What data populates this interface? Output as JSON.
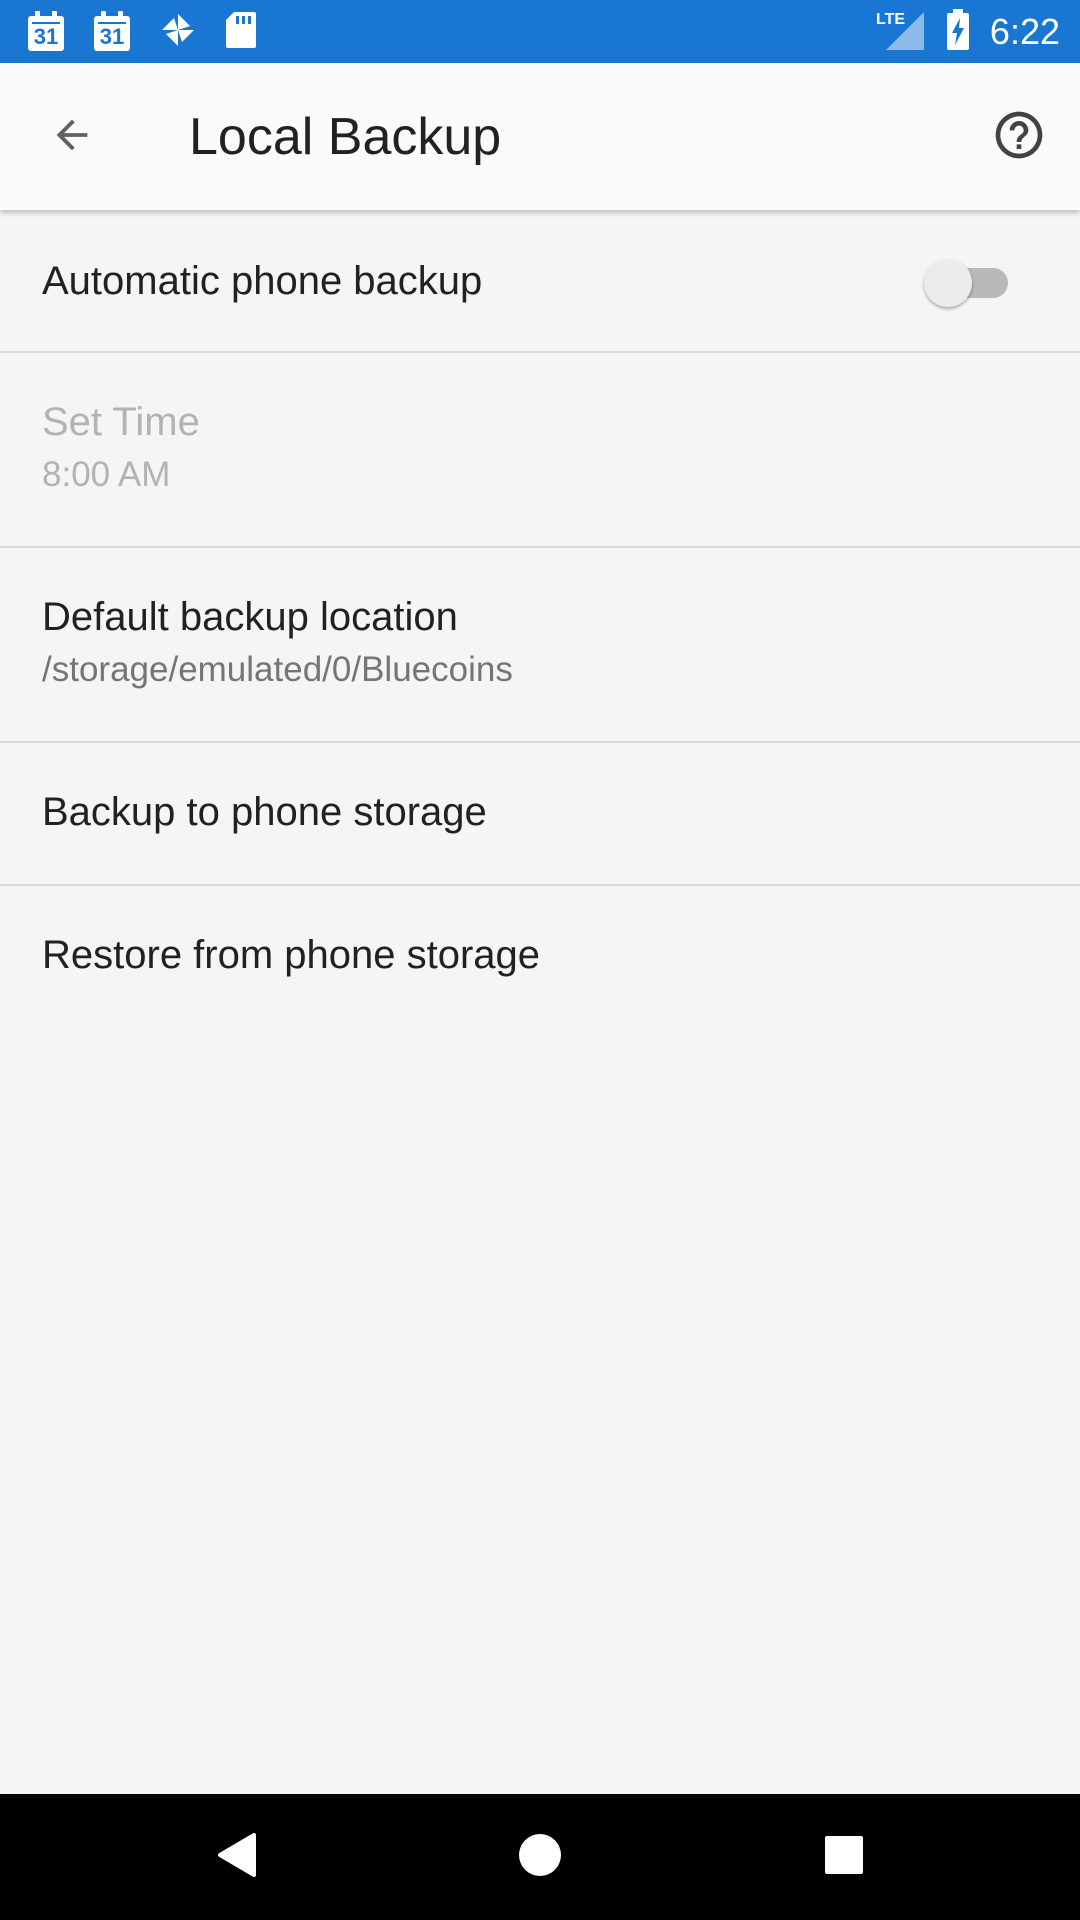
{
  "status_bar": {
    "calendar_day_1": "31",
    "calendar_day_2": "31",
    "network_label": "LTE",
    "time": "6:22",
    "icons": [
      "calendar-icon",
      "calendar-icon",
      "pinwheel-icon",
      "sd-card-icon",
      "lte-signal-icon",
      "battery-charging-icon"
    ],
    "background_color": "#1976d2"
  },
  "app_bar": {
    "title": "Local Backup",
    "back_icon": "arrow-back-icon",
    "help_icon": "help-circle-icon"
  },
  "settings": {
    "auto_backup": {
      "title": "Automatic phone backup",
      "enabled": false
    },
    "set_time": {
      "title": "Set Time",
      "summary": "8:00 AM",
      "disabled": true
    },
    "backup_location": {
      "title": "Default backup location",
      "summary": "/storage/emulated/0/Bluecoins"
    },
    "backup_to_storage": {
      "title": "Backup to phone storage"
    },
    "restore_from_storage": {
      "title": "Restore from phone storage"
    }
  },
  "nav_bar": {
    "icons": [
      "nav-back-icon",
      "nav-home-icon",
      "nav-recents-icon"
    ]
  }
}
